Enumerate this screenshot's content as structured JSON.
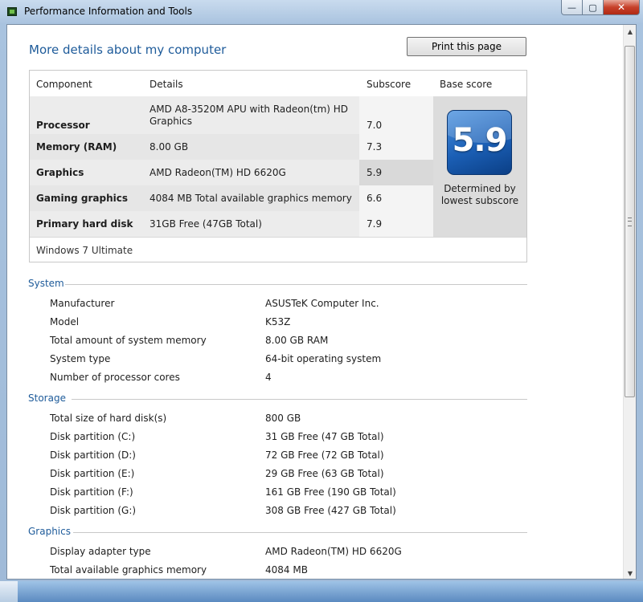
{
  "window": {
    "title": "Performance Information and Tools",
    "minimize_glyph": "—",
    "maximize_glyph": "▢",
    "close_glyph": "✕"
  },
  "page": {
    "heading": "More details about my computer",
    "print_label": "Print this page"
  },
  "score_table": {
    "headers": {
      "component": "Component",
      "details": "Details",
      "subscore": "Subscore",
      "base_score": "Base score"
    },
    "rows": [
      {
        "component": "Processor",
        "details": "AMD A8-3520M APU with Radeon(tm) HD Graphics",
        "subscore": "7.0"
      },
      {
        "component": "Memory (RAM)",
        "details": "8.00 GB",
        "subscore": "7.3"
      },
      {
        "component": "Graphics",
        "details": "AMD Radeon(TM) HD 6620G",
        "subscore": "5.9"
      },
      {
        "component": "Gaming graphics",
        "details": "4084 MB Total available graphics memory",
        "subscore": "6.6"
      },
      {
        "component": "Primary hard disk",
        "details": "31GB Free (47GB Total)",
        "subscore": "7.9"
      }
    ],
    "base_score": "5.9",
    "base_note": "Determined by lowest subscore",
    "os": "Windows 7 Ultimate"
  },
  "system": {
    "title": "System",
    "items": [
      {
        "label": "Manufacturer",
        "value": "ASUSTeK Computer Inc."
      },
      {
        "label": "Model",
        "value": "K53Z"
      },
      {
        "label": "Total amount of system memory",
        "value": "8.00 GB RAM"
      },
      {
        "label": "System type",
        "value": "64-bit operating system"
      },
      {
        "label": "Number of processor cores",
        "value": "4"
      }
    ]
  },
  "storage": {
    "title": "Storage",
    "items": [
      {
        "label": "Total size of hard disk(s)",
        "value": "800 GB"
      },
      {
        "label": "Disk partition (C:)",
        "value": "31 GB Free (47 GB Total)"
      },
      {
        "label": "Disk partition (D:)",
        "value": "72 GB Free (72 GB Total)"
      },
      {
        "label": "Disk partition (E:)",
        "value": "29 GB Free (63 GB Total)"
      },
      {
        "label": "Disk partition (F:)",
        "value": "161 GB Free (190 GB Total)"
      },
      {
        "label": "Disk partition (G:)",
        "value": "308 GB Free (427 GB Total)"
      }
    ]
  },
  "graphics": {
    "title": "Graphics",
    "items": [
      {
        "label": "Display adapter type",
        "value": "AMD Radeon(TM) HD 6620G"
      },
      {
        "label": "Total available graphics memory",
        "value": "4084 MB"
      }
    ]
  },
  "scrollbar": {
    "up_glyph": "▲",
    "down_glyph": "▼"
  }
}
